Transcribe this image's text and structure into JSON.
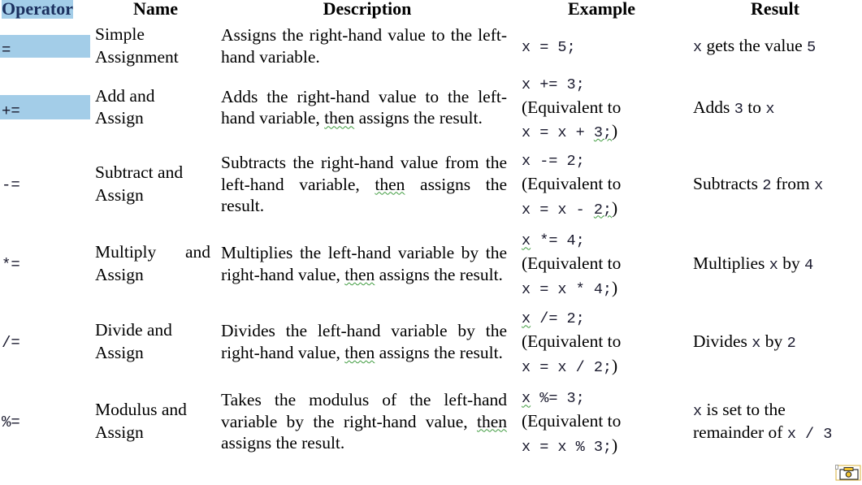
{
  "document": {
    "type": "compound-assignment-operators-table",
    "highlight_color": "#a3cde8",
    "header_text_color": "#1b2f5e",
    "code_text_color": "#1a1a2e",
    "squiggle_color": "#3f9b3f"
  },
  "table": {
    "headers": {
      "operator": "Operator",
      "name": "Name",
      "description": "Description",
      "example": "Example",
      "result": "Result"
    },
    "rows": [
      {
        "operator": "=",
        "highlighted": true,
        "name_line1": "Simple",
        "name_line2": "Assignment",
        "description": "Assigns the right-hand value to the left-hand variable.",
        "desc_part1": "Assigns the right-hand value to the left-hand variable.",
        "example_code": "x = 5;",
        "example_equiv": "",
        "example_equiv_code": "",
        "result_code1": "x",
        "result_text": " gets the value ",
        "result_code2": "5"
      },
      {
        "operator": "+=",
        "highlighted": true,
        "name_line1": "Add and",
        "name_line2": "Assign",
        "description": "Adds the right-hand value to the left-hand variable, then assigns the result.",
        "desc_a": "Adds the right-hand value to the left-hand variable, ",
        "desc_squiggle": "then",
        "desc_b": " assigns the result.",
        "example_code": "x += 3;",
        "example_equiv": "(Equivalent to ",
        "example_eq_code1": "x = x + ",
        "example_eq_squiggle": "3;",
        "example_eq_close": ")",
        "result_text1": "Adds ",
        "result_code1": "3",
        "result_text2": " to ",
        "result_code2": "x"
      },
      {
        "operator": "-=",
        "highlighted": false,
        "name_line1": "Subtract and",
        "name_line2": "Assign",
        "description": "Subtracts the right-hand value from the left-hand variable, then assigns the result.",
        "desc_a": "Subtracts the right-hand value from the left-hand variable, ",
        "desc_squiggle": "then",
        "desc_b": " assigns the result.",
        "example_code": "x -= 2;",
        "example_equiv": "(Equivalent to ",
        "example_eq_code1": "x = x - ",
        "example_eq_squiggle": "2;",
        "example_eq_close": ")",
        "result_text1": "Subtracts ",
        "result_code1": "2",
        "result_text2": " from ",
        "result_code2": "x"
      },
      {
        "operator": "*=",
        "highlighted": false,
        "name_line1": "Multiply and",
        "name_line2": "Assign",
        "description": "Multiplies the left-hand variable by the right-hand value, then assigns the result.",
        "desc_a": "Multiplies the left-hand variable by the right-hand value, ",
        "desc_squiggle": "then",
        "desc_b": " assigns the result.",
        "example_code_squiggle": "x",
        "example_code": " *= 4;",
        "example_equiv": "(Equivalent to ",
        "example_eq_code1": "x = x * 4;",
        "example_eq_squiggle": "",
        "example_eq_close": ")",
        "result_text1": "Multiplies ",
        "result_code1": "x",
        "result_text2": " by ",
        "result_code2": "4"
      },
      {
        "operator": "/=",
        "highlighted": false,
        "name_line1": "Divide and",
        "name_line2": "Assign",
        "description": "Divides the left-hand variable by the right-hand value, then assigns the result.",
        "desc_a": "Divides the left-hand variable by the right-hand value, ",
        "desc_squiggle": "then",
        "desc_b": " assigns the result.",
        "example_code_squiggle": "x",
        "example_code": " /= 2;",
        "example_equiv": "(Equivalent to ",
        "example_eq_code1": "x = x / 2;",
        "example_eq_squiggle": "",
        "example_eq_close": ")",
        "result_text1": "Divides ",
        "result_code1": "x",
        "result_text2": " by ",
        "result_code2": "2"
      },
      {
        "operator": "%=",
        "highlighted": false,
        "name_line1": "Modulus and",
        "name_line2": "Assign",
        "description": "Takes the modulus of the left-hand variable by the right-hand value, then assigns the result.",
        "desc_a": "Takes the modulus of the left-hand variable by the right-hand value, ",
        "desc_squiggle": "then",
        "desc_b": " assigns the result.",
        "example_code_squiggle": "x",
        "example_code": " %= 3;",
        "example_equiv": "(Equivalent to ",
        "example_eq_code1": "x = x % 3;",
        "example_eq_squiggle": "",
        "example_eq_close": ")",
        "result_code1": "x",
        "result_text1": " is set to the remainder of ",
        "result_code2": "x / 3"
      }
    ]
  },
  "corner": {
    "icon": "image-placeholder-icon"
  }
}
